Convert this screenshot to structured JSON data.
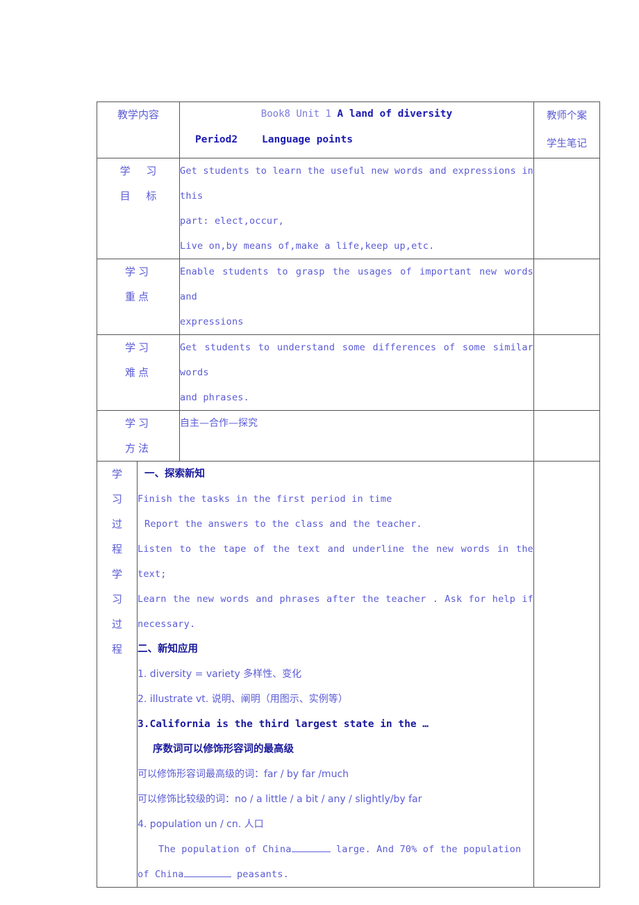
{
  "document": {
    "type": "lesson-plan-table",
    "text_color": "#5b5bd6",
    "heading_color": "#1a1a9c",
    "border_color": "#555555"
  },
  "header": {
    "topic_label": "教学内容",
    "title_prefix": "Book8 Unit 1",
    "title_main": "A land of diversity",
    "period_label": "Period2",
    "period_topic": "Language points",
    "notes_line_1": "教师个案",
    "notes_line_2": "学生笔记"
  },
  "rows": [
    {
      "label_lines": [
        "学 习",
        "目 标"
      ],
      "lines": [
        "Get students to learn the useful new words and expressions in this",
        "part: elect,occur,",
        "Live on,by means of,make a life,keep up,etc."
      ]
    },
    {
      "label_lines": [
        "学习",
        "重点"
      ],
      "lines": [
        "Enable students to grasp the usages of important new words and",
        "expressions"
      ]
    },
    {
      "label_lines": [
        "学习",
        "难点"
      ],
      "lines": [
        "Get students to understand some differences of some similar words",
        "and phrases."
      ]
    },
    {
      "label_lines": [
        "学习",
        "方法"
      ],
      "lines": [
        "自主—合作—探究"
      ]
    }
  ],
  "process": {
    "label_chars": [
      "学",
      "习",
      "过",
      "程",
      "学",
      "习",
      "过",
      "程"
    ],
    "section_1_heading": "一、探索新知",
    "section_1_lines": [
      "Finish the tasks in the first period in time",
      "Report the answers to the class and the teacher.",
      "Listen to the tape of the text and underline the new words in the",
      "text;",
      "Learn the new words and phrases after the teacher . Ask for help if",
      "necessary."
    ],
    "section_2_heading": "二、新知应用",
    "item_1": "1. diversity = variety 多样性、变化",
    "item_2": "2. illustrate vt. 说明、阐明（用图示、实例等）",
    "item_3": "3.California is the third largest state in the …",
    "item_3_note": "序数词可以修饰形容词的最高级",
    "rule_superlative": "可以修饰形容词最高级的词：far / by far /much",
    "rule_comparative": "可以修饰比较级的词：no / a little / a bit / any / slightly/by far",
    "item_4": "4. population    un / cn. 人口",
    "example_part_1": "The population of China",
    "example_part_2": "large. And 70% of the population",
    "example_part_3": "of China",
    "example_part_4": "peasants."
  }
}
